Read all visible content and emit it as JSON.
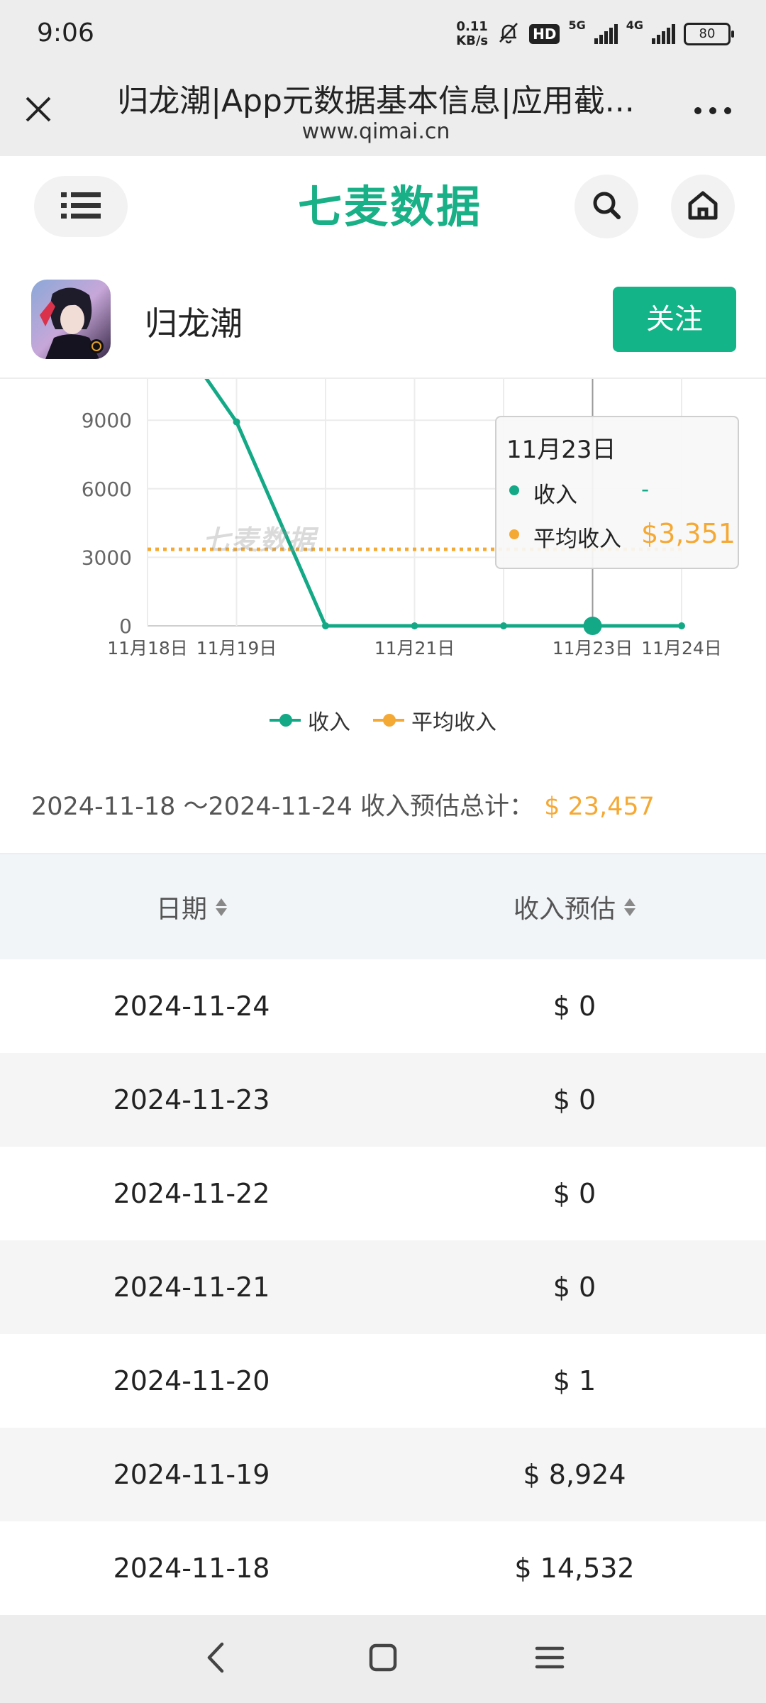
{
  "status_bar": {
    "time": "9:06",
    "net_speed_value": "0.11",
    "net_speed_unit": "KB/s",
    "hd_badge": "HD",
    "sig1_label": "5G",
    "sig2_label": "4G",
    "battery": "80"
  },
  "browser": {
    "title": "归龙潮|App元数据基本信息|应用截...",
    "url": "www.qimai.cn"
  },
  "site": {
    "logo_text": "七麦数据",
    "icons": {
      "menu": "list-icon",
      "search": "search-icon",
      "home": "home-icon"
    }
  },
  "app": {
    "name": "归龙潮",
    "follow_label": "关注"
  },
  "chart_data": {
    "type": "line",
    "x": [
      "11月18日",
      "11月19日",
      "11月20日",
      "11月21日",
      "11月22日",
      "11月23日",
      "11月24日"
    ],
    "x_tick_labels": [
      "11月18日",
      "11月19日",
      "11月21日",
      "11月23日",
      "11月24日"
    ],
    "y_ticks": [
      "0",
      "3000",
      "6000",
      "9000"
    ],
    "ylim": [
      0,
      12000
    ],
    "series": [
      {
        "name": "收入",
        "values": [
          14532,
          8924,
          1,
          0,
          0,
          0,
          0
        ],
        "color": "#14a986"
      },
      {
        "name": "平均收入",
        "values": [
          3351,
          3351,
          3351,
          3351,
          3351,
          3351,
          3351
        ],
        "color": "#f5a935",
        "style": "dotted"
      }
    ],
    "highlight_index": 5,
    "grid": true,
    "legend_position": "bottom-center",
    "watermark": "七麦数据",
    "tooltip": {
      "date": "11月23日",
      "items": [
        {
          "label": "收入",
          "value": "-"
        },
        {
          "label": "平均收入",
          "value": "$3,351"
        }
      ]
    }
  },
  "summary": {
    "label": "2024-11-18 ～2024-11-24 收入预估总计：",
    "value": "$ 23,457"
  },
  "table": {
    "headers": [
      "日期",
      "收入预估"
    ],
    "rows": [
      {
        "date": "2024-11-24",
        "revenue": "$ 0"
      },
      {
        "date": "2024-11-23",
        "revenue": "$ 0"
      },
      {
        "date": "2024-11-22",
        "revenue": "$ 0"
      },
      {
        "date": "2024-11-21",
        "revenue": "$ 0"
      },
      {
        "date": "2024-11-20",
        "revenue": "$ 1"
      },
      {
        "date": "2024-11-19",
        "revenue": "$ 8,924"
      },
      {
        "date": "2024-11-18",
        "revenue": "$ 14,532"
      }
    ]
  }
}
